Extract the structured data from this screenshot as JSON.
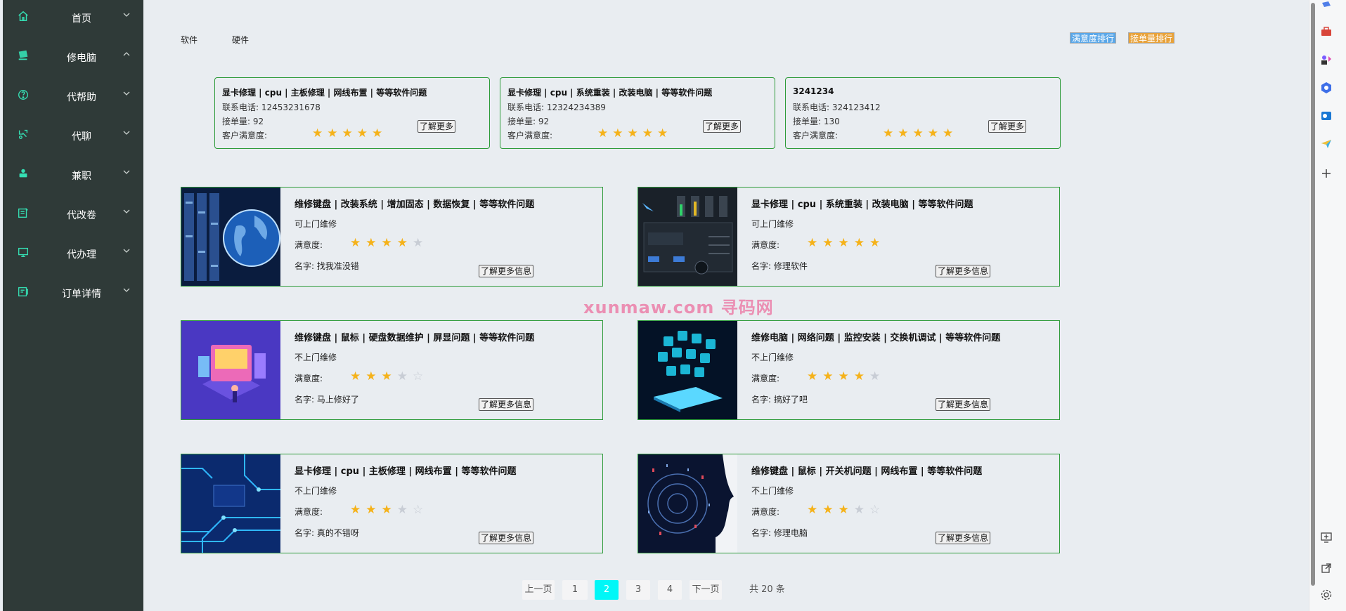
{
  "sidebar": {
    "items": [
      {
        "label": "首页",
        "icon": "home-icon"
      },
      {
        "label": "修电脑",
        "icon": "computer-icon"
      },
      {
        "label": "代帮助",
        "icon": "help-icon"
      },
      {
        "label": "代聊",
        "icon": "chat-icon"
      },
      {
        "label": "兼职",
        "icon": "part-time-icon"
      },
      {
        "label": "代改卷",
        "icon": "grading-icon"
      },
      {
        "label": "代办理",
        "icon": "monitor-icon"
      },
      {
        "label": "订单详情",
        "icon": "order-icon"
      }
    ]
  },
  "filters": {
    "software": "软件",
    "hardware": "硬件",
    "rank_satisfaction": "满意度排行",
    "rank_orders": "接单量排行",
    "rank_satisfaction_color": "#5aa7e8",
    "rank_orders_color": "#e8a23a"
  },
  "top_cards": [
    {
      "title": "显卡修理 | cpu | 主板修理 | 网线布置 | 等等软件问题",
      "phone_label": "联系电话:",
      "phone": "12453231678",
      "count_label": "接单量:",
      "count": "92",
      "sat_label": "客户满意度:",
      "stars": 5,
      "more": "了解更多"
    },
    {
      "title": "显卡修理 | cpu | 系统重装 | 改装电脑 | 等等软件问题",
      "phone_label": "联系电话:",
      "phone": "12324234389",
      "count_label": "接单量:",
      "count": "92",
      "sat_label": "客户满意度:",
      "stars": 5,
      "more": "了解更多"
    },
    {
      "title": "3241234",
      "phone_label": "联系电话:",
      "phone": "324123412",
      "count_label": "接单量:",
      "count": "130",
      "sat_label": "客户满意度:",
      "stars": 5,
      "more": "了解更多"
    }
  ],
  "cards": [
    {
      "title": "维修键盘 | 改装系统 | 增加固态 | 数据恢复 | 等等软件问题",
      "visit": "可上门维修",
      "sat_label": "满意度:",
      "stars": 4,
      "name": "名字: 找我准没错",
      "more": "了解更多信息",
      "thumb": "server-globe"
    },
    {
      "title": "显卡修理 | cpu | 系统重装 | 改装电脑 | 等等软件问题",
      "visit": "可上门维修",
      "sat_label": "满意度:",
      "stars": 5,
      "name": "名字: 修理软件",
      "more": "了解更多信息",
      "thumb": "audio-mixer"
    },
    {
      "title": "维修键盘 | 鼠标 | 硬盘数据维护 | 屏显问题 | 等等软件问题",
      "visit": "不上门维修",
      "sat_label": "满意度:",
      "stars": 3,
      "name": "名字: 马上修好了",
      "more": "了解更多信息",
      "thumb": "isometric-screen"
    },
    {
      "title": "维修电脑 | 网络问题 | 监控安装 | 交换机调试 | 等等软件问题",
      "visit": "不上门维修",
      "sat_label": "满意度:",
      "stars": 4,
      "name": "名字: 搞好了吧",
      "more": "了解更多信息",
      "thumb": "tablet-icons"
    },
    {
      "title": "显卡修理 | cpu | 主板修理 | 网线布置 | 等等软件问题",
      "visit": "不上门维修",
      "sat_label": "满意度:",
      "stars": 3,
      "name": "名字: 真的不错呀",
      "more": "了解更多信息",
      "thumb": "circuit-board"
    },
    {
      "title": "维修键盘 | 鼠标 | 开关机问题 | 网线布置 | 等等软件问题",
      "visit": "不上门维修",
      "sat_label": "满意度:",
      "stars": 3,
      "name": "名字: 修理电脑",
      "more": "了解更多信息",
      "thumb": "binary-head"
    }
  ],
  "watermark": "xunmaw.com 寻码网",
  "pagination": {
    "prev": "上一页",
    "pages": [
      "1",
      "2",
      "3",
      "4"
    ],
    "current": "2",
    "next": "下一页",
    "total": "共 20 条",
    "active_color": "#00f7f7"
  }
}
